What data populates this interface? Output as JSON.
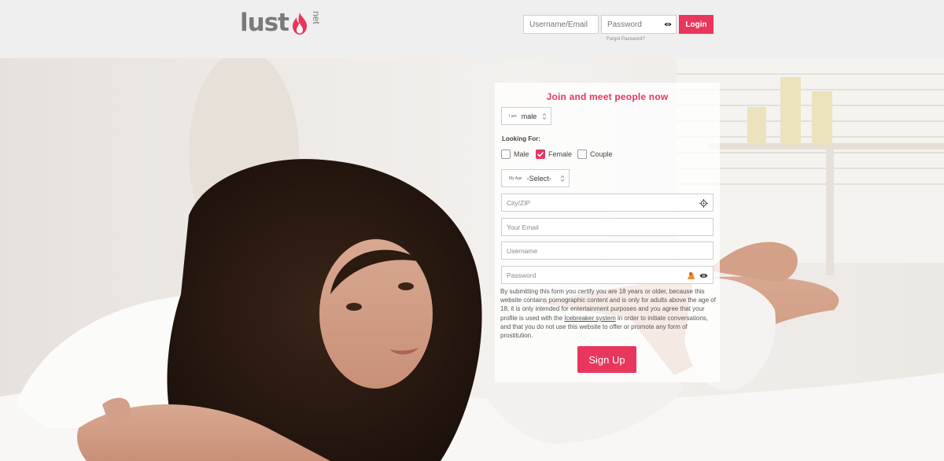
{
  "header": {
    "logo_word": "lust",
    "logo_suffix": "net",
    "username_placeholder": "Username/Email",
    "password_placeholder": "Password",
    "login_label": "Login",
    "forgot_label": "Forgot Password?"
  },
  "signup": {
    "title": "Join and meet people now",
    "gender_label": "I am",
    "gender_value": "male",
    "looking_for_label": "Looking For:",
    "options": [
      {
        "label": "Male",
        "checked": false
      },
      {
        "label": "Female",
        "checked": true
      },
      {
        "label": "Couple",
        "checked": false
      }
    ],
    "age_label": "My Age",
    "age_value": "-Select-",
    "city_placeholder": "City/ZIP",
    "email_placeholder": "Your Email",
    "username_placeholder": "Username",
    "password_placeholder": "Password",
    "disclaimer_before": "By submitting this form you certify you are 18 years or older, because this website contains pornographic content and is only for adults above the age of 18, it is only intended for entertainment purposes and you agree that your profile is used with the ",
    "disclaimer_link": "Icebreaker system",
    "disclaimer_after": " in order to initiate conversations, and that you do not use this website to offer or promote any form of prostitution.",
    "submit_label": "Sign Up"
  },
  "colors": {
    "accent": "#e8365d",
    "header_bg": "#efefef",
    "logo_gray": "#7a7a7a"
  },
  "icons": [
    "flame-logo-icon",
    "eye-icon",
    "location-target-icon",
    "password-manager-icon",
    "select-arrows-icon"
  ]
}
